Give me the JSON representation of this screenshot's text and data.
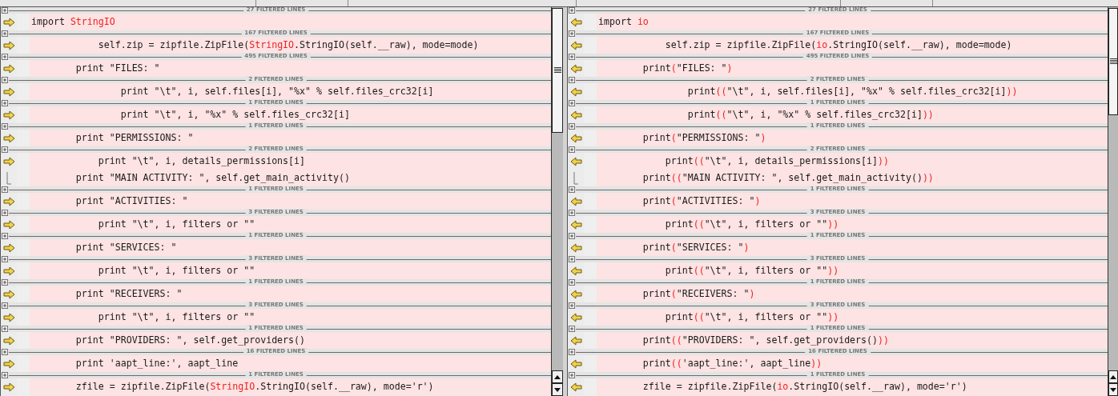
{
  "panes": [
    {
      "copies_to_right": true,
      "blocks": [
        {
          "separator": "27 FILTERED LINES",
          "lines": [
            [
              {
                "text": "import "
              },
              {
                "text": "StringIO",
                "changed": true
              }
            ]
          ]
        },
        {
          "separator": "167 FILTERED LINES",
          "lines": [
            [
              {
                "text": "            self.zip = zipfile.ZipFile("
              },
              {
                "text": "StringIO",
                "changed": true
              },
              {
                "text": ".StringIO(self.__raw), mode=mode)"
              }
            ]
          ]
        },
        {
          "separator": "495 FILTERED LINES",
          "lines": [
            [
              {
                "text": "        print \"FILES: \""
              }
            ]
          ]
        },
        {
          "separator": "2 FILTERED LINES",
          "lines": [
            [
              {
                "text": "                print \"\\t\", i, self.files[i], \"%x\" % self.files_crc32[i]"
              }
            ]
          ]
        },
        {
          "separator": "1 FILTERED LINES",
          "lines": [
            [
              {
                "text": "                print \"\\t\", i, \"%x\" % self.files_crc32[i]"
              }
            ]
          ]
        },
        {
          "separator": "1 FILTERED LINES",
          "lines": [
            [
              {
                "text": "        print \"PERMISSIONS: \""
              }
            ]
          ]
        },
        {
          "separator": "2 FILTERED LINES",
          "lines": [
            [
              {
                "text": "            print \"\\t\", i, details_permissions[i]"
              }
            ],
            [
              {
                "text": "        print \"MAIN ACTIVITY: \", self.get_main_activity()"
              }
            ]
          ]
        },
        {
          "separator": "1 FILTERED LINES",
          "lines": [
            [
              {
                "text": "        print \"ACTIVITIES: \""
              }
            ]
          ]
        },
        {
          "separator": "3 FILTERED LINES",
          "lines": [
            [
              {
                "text": "            print \"\\t\", i, filters or \"\""
              }
            ]
          ]
        },
        {
          "separator": "1 FILTERED LINES",
          "lines": [
            [
              {
                "text": "        print \"SERVICES: \""
              }
            ]
          ]
        },
        {
          "separator": "3 FILTERED LINES",
          "lines": [
            [
              {
                "text": "            print \"\\t\", i, filters or \"\""
              }
            ]
          ]
        },
        {
          "separator": "1 FILTERED LINES",
          "lines": [
            [
              {
                "text": "        print \"RECEIVERS: \""
              }
            ]
          ]
        },
        {
          "separator": "3 FILTERED LINES",
          "lines": [
            [
              {
                "text": "            print \"\\t\", i, filters or \"\""
              }
            ]
          ]
        },
        {
          "separator": "1 FILTERED LINES",
          "lines": [
            [
              {
                "text": "        print \"PROVIDERS: \", self.get_providers()"
              }
            ]
          ]
        },
        {
          "separator": "16 FILTERED LINES",
          "lines": [
            [
              {
                "text": "        print 'aapt_line:', aapt_line"
              }
            ]
          ]
        },
        {
          "separator": "1 FILTERED LINES",
          "lines": [
            [
              {
                "text": "        zfile = zipfile.ZipFile("
              },
              {
                "text": "StringIO",
                "changed": true
              },
              {
                "text": ".StringIO(self.__raw), mode='r')"
              }
            ]
          ]
        }
      ]
    },
    {
      "copies_to_right": false,
      "blocks": [
        {
          "separator": "27 FILTERED LINES",
          "lines": [
            [
              {
                "text": "import "
              },
              {
                "text": "io",
                "changed": true
              }
            ]
          ]
        },
        {
          "separator": "167 FILTERED LINES",
          "lines": [
            [
              {
                "text": "            self.zip = zipfile.ZipFile("
              },
              {
                "text": "io",
                "changed": true
              },
              {
                "text": ".StringIO(self.__raw), mode=mode)"
              }
            ]
          ]
        },
        {
          "separator": "495 FILTERED LINES",
          "lines": [
            [
              {
                "text": "        print"
              },
              {
                "text": "(",
                "changed": true
              },
              {
                "text": "\"FILES: \""
              },
              {
                "text": ")",
                "changed": true
              }
            ]
          ]
        },
        {
          "separator": "2 FILTERED LINES",
          "lines": [
            [
              {
                "text": "                print"
              },
              {
                "text": "((",
                "changed": true
              },
              {
                "text": "\"\\t\", i, self.files[i], \"%x\" % self.files_crc32[i]"
              },
              {
                "text": "))",
                "changed": true
              }
            ]
          ]
        },
        {
          "separator": "1 FILTERED LINES",
          "lines": [
            [
              {
                "text": "                print"
              },
              {
                "text": "((",
                "changed": true
              },
              {
                "text": "\"\\t\", i, \"%x\" % self.files_crc32[i]"
              },
              {
                "text": "))",
                "changed": true
              }
            ]
          ]
        },
        {
          "separator": "1 FILTERED LINES",
          "lines": [
            [
              {
                "text": "        print"
              },
              {
                "text": "(",
                "changed": true
              },
              {
                "text": "\"PERMISSIONS: \""
              },
              {
                "text": ")",
                "changed": true
              }
            ]
          ]
        },
        {
          "separator": "2 FILTERED LINES",
          "lines": [
            [
              {
                "text": "            print"
              },
              {
                "text": "((",
                "changed": true
              },
              {
                "text": "\"\\t\", i, details_permissions[i]"
              },
              {
                "text": "))",
                "changed": true
              }
            ],
            [
              {
                "text": "        print"
              },
              {
                "text": "((",
                "changed": true
              },
              {
                "text": "\"MAIN ACTIVITY: \", self.get_main_activity()"
              },
              {
                "text": "))",
                "changed": true
              }
            ]
          ]
        },
        {
          "separator": "1 FILTERED LINES",
          "lines": [
            [
              {
                "text": "        print"
              },
              {
                "text": "(",
                "changed": true
              },
              {
                "text": "\"ACTIVITIES: \""
              },
              {
                "text": ")",
                "changed": true
              }
            ]
          ]
        },
        {
          "separator": "3 FILTERED LINES",
          "lines": [
            [
              {
                "text": "            print"
              },
              {
                "text": "((",
                "changed": true
              },
              {
                "text": "\"\\t\", i, filters or \"\""
              },
              {
                "text": "))",
                "changed": true
              }
            ]
          ]
        },
        {
          "separator": "1 FILTERED LINES",
          "lines": [
            [
              {
                "text": "        print"
              },
              {
                "text": "(",
                "changed": true
              },
              {
                "text": "\"SERVICES: \""
              },
              {
                "text": ")",
                "changed": true
              }
            ]
          ]
        },
        {
          "separator": "3 FILTERED LINES",
          "lines": [
            [
              {
                "text": "            print"
              },
              {
                "text": "((",
                "changed": true
              },
              {
                "text": "\"\\t\", i, filters or \"\""
              },
              {
                "text": "))",
                "changed": true
              }
            ]
          ]
        },
        {
          "separator": "1 FILTERED LINES",
          "lines": [
            [
              {
                "text": "        print"
              },
              {
                "text": "(",
                "changed": true
              },
              {
                "text": "\"RECEIVERS: \""
              },
              {
                "text": ")",
                "changed": true
              }
            ]
          ]
        },
        {
          "separator": "3 FILTERED LINES",
          "lines": [
            [
              {
                "text": "            print"
              },
              {
                "text": "((",
                "changed": true
              },
              {
                "text": "\"\\t\", i, filters or \"\""
              },
              {
                "text": "))",
                "changed": true
              }
            ]
          ]
        },
        {
          "separator": "1 FILTERED LINES",
          "lines": [
            [
              {
                "text": "        print"
              },
              {
                "text": "((",
                "changed": true
              },
              {
                "text": "\"PROVIDERS: \", self.get_providers()"
              },
              {
                "text": "))",
                "changed": true
              }
            ]
          ]
        },
        {
          "separator": "16 FILTERED LINES",
          "lines": [
            [
              {
                "text": "        print"
              },
              {
                "text": "((",
                "changed": true
              },
              {
                "text": "'aapt_line:', aapt_line"
              },
              {
                "text": "))",
                "changed": true
              }
            ]
          ]
        },
        {
          "separator": "1 FILTERED LINES",
          "lines": [
            [
              {
                "text": "        zfile = zipfile.ZipFile("
              },
              {
                "text": "io",
                "changed": true
              },
              {
                "text": ".StringIO(self.__raw), mode='r')"
              }
            ]
          ]
        }
      ]
    }
  ]
}
